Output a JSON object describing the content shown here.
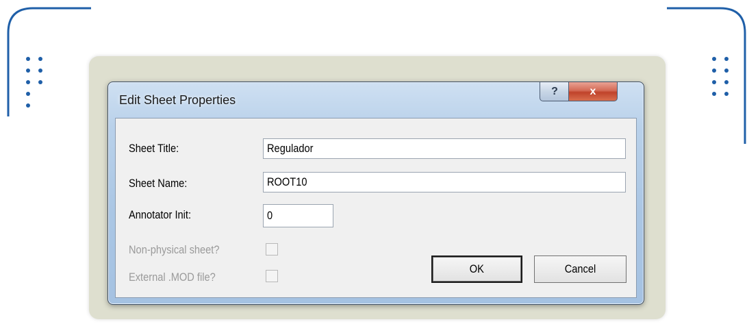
{
  "dialog": {
    "title": "Edit Sheet Properties",
    "help_glyph": "?",
    "close_glyph": "x"
  },
  "form": {
    "sheet_title_label": "Sheet Title:",
    "sheet_title_value": "Regulador",
    "sheet_name_label": "Sheet Name:",
    "sheet_name_value": "ROOT10",
    "annotator_init_label": "Annotator Init:",
    "annotator_init_value": "0",
    "non_physical_label": "Non-physical sheet?",
    "non_physical_checked": false,
    "external_mod_label": "External .MOD file?",
    "external_mod_checked": false
  },
  "buttons": {
    "ok_label": "OK",
    "cancel_label": "Cancel"
  },
  "colors": {
    "frame_accent": "#1f5fa8",
    "backdrop": "#dedfcf",
    "close_button": "#c0432a"
  }
}
